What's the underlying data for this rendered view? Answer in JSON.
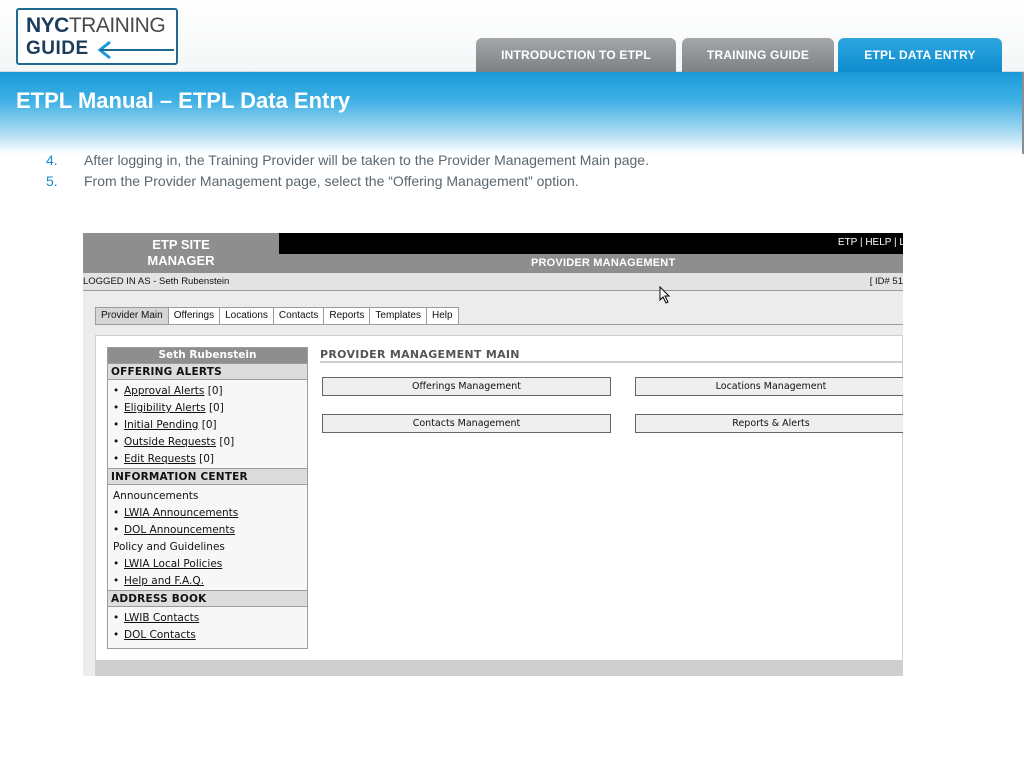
{
  "header": {
    "logo": {
      "line1_bold": "NYC",
      "line1_rest": "TRAINING",
      "line2": "GUIDE"
    },
    "tabs": [
      {
        "label": "INTRODUCTION TO ETPL"
      },
      {
        "label": "TRAINING GUIDE"
      },
      {
        "label": "ETPL DATA ENTRY"
      }
    ],
    "colors": {
      "active_tab": "#1a9ad9",
      "inactive_tab": "#8e9396",
      "banner": "#1a9ad9"
    }
  },
  "banner": {
    "title": "ETPL Manual – ETPL Data Entry"
  },
  "steps": [
    {
      "num": "4.",
      "text": "After logging in, the Training Provider will be taken to the Provider Management Main page."
    },
    {
      "num": "5.",
      "text": "From the Provider Management page, select the  “Offering Management” option."
    }
  ],
  "screenshot": {
    "site_logo": {
      "line1": "ETP SITE",
      "line2": "MANAGER"
    },
    "top_links": "ETP | HELP | L",
    "section_title": "PROVIDER MANAGEMENT",
    "logged_in": "LOGGED IN AS - Seth Rubenstein",
    "id_text": "[ ID# 51",
    "subtabs": [
      "Provider Main",
      "Offerings",
      "Locations",
      "Contacts",
      "Reports",
      "Templates",
      "Help"
    ],
    "active_subtab": "Provider Main",
    "sidebar": {
      "user": "Seth Rubenstein",
      "offering_alerts": {
        "title": "OFFERING ALERTS",
        "items": [
          {
            "label": "Approval Alerts",
            "count": "[0]"
          },
          {
            "label": "Eligibility Alerts",
            "count": "[0]"
          },
          {
            "label": "Initial Pending",
            "count": "[0]"
          },
          {
            "label": "Outside Requests",
            "count": "[0]"
          },
          {
            "label": "Edit Requests",
            "count": "[0]"
          }
        ]
      },
      "info_center": {
        "title": "INFORMATION CENTER",
        "announcements_label": "Announcements",
        "announcements": [
          "LWIA Announcements",
          "DOL Announcements"
        ],
        "policy_label": "Policy and Guidelines",
        "policies": [
          "LWIA Local Policies",
          "Help and F.A.Q."
        ]
      },
      "address_book": {
        "title": "ADDRESS BOOK",
        "items": [
          "LWIB Contacts",
          "DOL Contacts"
        ]
      }
    },
    "main": {
      "title": "PROVIDER MANAGEMENT MAIN",
      "buttons": {
        "offerings": "Offerings Management",
        "locations": "Locations Management",
        "contacts": "Contacts Management",
        "reports": "Reports & Alerts"
      }
    },
    "bullet": "•"
  }
}
